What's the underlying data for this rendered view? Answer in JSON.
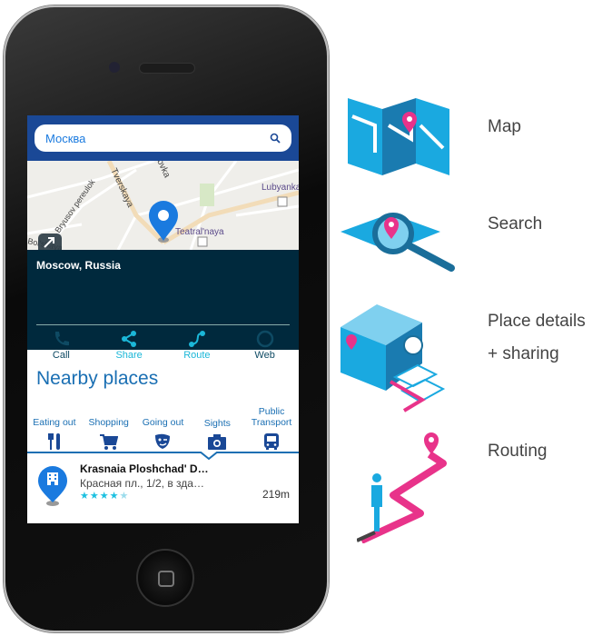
{
  "search": {
    "value": "Москва",
    "icon": "search-icon"
  },
  "map": {
    "labels": [
      "Tverskaya",
      "Bryusov pereulok",
      "ovka",
      "Lubyanka",
      "Teatral'naya",
      "Bol'shaya"
    ]
  },
  "place": {
    "title": "Moscow, Russia"
  },
  "actions": [
    {
      "label": "Call",
      "icon": "phone-icon",
      "enabled": false
    },
    {
      "label": "Share",
      "icon": "share-icon",
      "enabled": true
    },
    {
      "label": "Route",
      "icon": "route-icon",
      "enabled": true
    },
    {
      "label": "Web",
      "icon": "globe-icon",
      "enabled": false
    }
  ],
  "nearby": {
    "title": "Nearby places",
    "categories": [
      {
        "label": "Eating out",
        "icon": "fork-knife-icon"
      },
      {
        "label": "Shopping",
        "icon": "cart-icon"
      },
      {
        "label": "Going out",
        "icon": "mask-icon"
      },
      {
        "label": "Sights",
        "icon": "camera-icon",
        "selected": true
      },
      {
        "label": "Public Transport",
        "icon": "bus-icon"
      }
    ],
    "items": [
      {
        "name": "Krasnaia Ploshchad' D…",
        "address": "Красная пл., 1/2, в зда…",
        "distance": "219m",
        "rating": 4.5
      }
    ]
  },
  "features": [
    {
      "label": "Map"
    },
    {
      "label": "Search"
    },
    {
      "label": "Place details",
      "label2": "+ sharing"
    },
    {
      "label": "Routing"
    }
  ],
  "colors": {
    "accent": "#1a6fb3",
    "header": "#1a4896",
    "details_bg": "#00293d",
    "illustration_blue": "#1aa9e0",
    "illustration_pink": "#e8338a"
  }
}
